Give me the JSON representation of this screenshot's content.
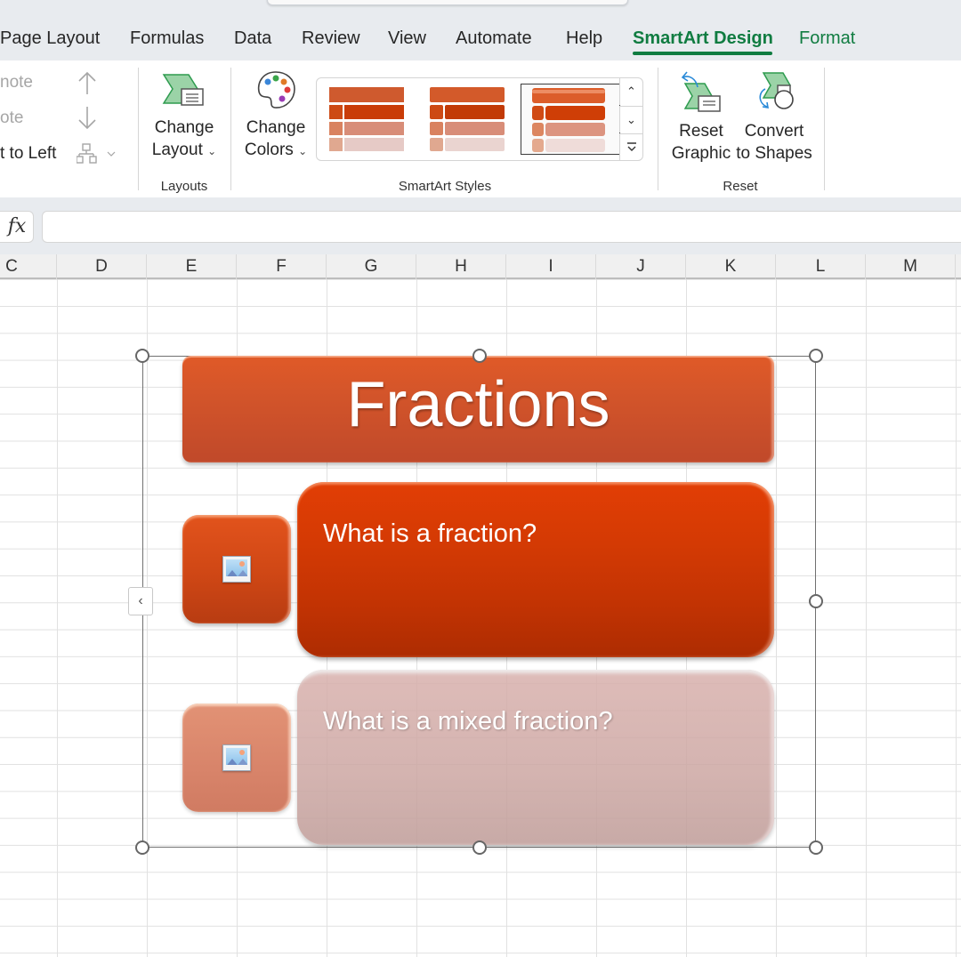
{
  "ribbon_tabs": [
    {
      "label": "Page Layout"
    },
    {
      "label": "Formulas"
    },
    {
      "label": "Data"
    },
    {
      "label": "Review"
    },
    {
      "label": "View"
    },
    {
      "label": "Automate"
    },
    {
      "label": "Help"
    },
    {
      "label": "SmartArt Design",
      "active": true
    },
    {
      "label": "Format"
    }
  ],
  "ribbon": {
    "create_graphic": {
      "promote_label": "note",
      "demote_label": "ote",
      "right_to_left_label": "t to Left"
    },
    "layouts": {
      "change_layout_line1": "Change",
      "change_layout_line2": "Layout",
      "group_label": "Layouts"
    },
    "smartart_styles": {
      "change_colors_line1": "Change",
      "change_colors_line2": "Colors",
      "group_label": "SmartArt Styles",
      "gallery_selected_index": 2,
      "gallery_count_visible": 3
    },
    "reset": {
      "reset_graphic_line1": "Reset",
      "reset_graphic_line2": "Graphic",
      "convert_line1": "Convert",
      "convert_line2": "to Shapes",
      "group_label": "Reset"
    }
  },
  "formula_bar": {
    "fx_label": "fx",
    "value": ""
  },
  "columns": [
    "C",
    "D",
    "E",
    "F",
    "G",
    "H",
    "I",
    "J",
    "K",
    "L",
    "M"
  ],
  "smartart": {
    "title": "Fractions",
    "items": [
      {
        "text": "What is a fraction?",
        "image_placeholder": "picture-icon"
      },
      {
        "text": "What is a mixed fraction?",
        "image_placeholder": "picture-icon"
      }
    ],
    "text_pane_toggle": "‹"
  },
  "colors": {
    "accent_green": "#107c41",
    "title_orange": "#d2542a",
    "item1_orange": "#d43a04",
    "item2_faded": "#cfa8a4"
  }
}
